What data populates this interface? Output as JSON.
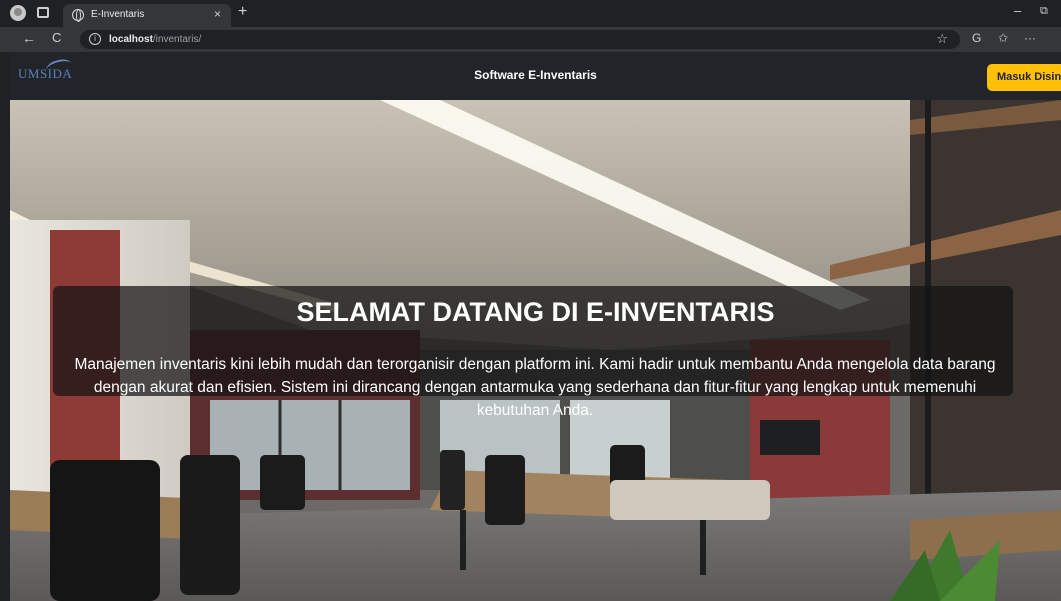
{
  "browser": {
    "tab_title": "E-Inventaris",
    "tab_close": "×",
    "new_tab": "+",
    "url_host": "localhost",
    "url_path": "/inventaris/",
    "back": "←",
    "reload": "C",
    "star": "☆",
    "extensions_icon": "ꟷ",
    "favorites_icon": "✩",
    "more": "···",
    "minimize": "–",
    "restore": "⧉"
  },
  "navbar": {
    "logo_text": "UMSIDA",
    "title": "Software E-Inventaris",
    "login_button": "Masuk Disini"
  },
  "hero": {
    "title": "SELAMAT DATANG DI E-INVENTARIS",
    "description": "Manajemen inventaris kini lebih mudah dan terorganisir dengan platform ini. Kami hadir untuk membantu Anda mengelola data barang dengan akurat dan efisien. Sistem ini dirancang dengan antarmuka yang sederhana dan fitur-fitur yang lengkap untuk memenuhi kebutuhan Anda."
  },
  "colors": {
    "navbar_bg": "#212529",
    "login_button_bg": "#ffc107",
    "overlay": "rgba(20,20,20,0.72)"
  }
}
